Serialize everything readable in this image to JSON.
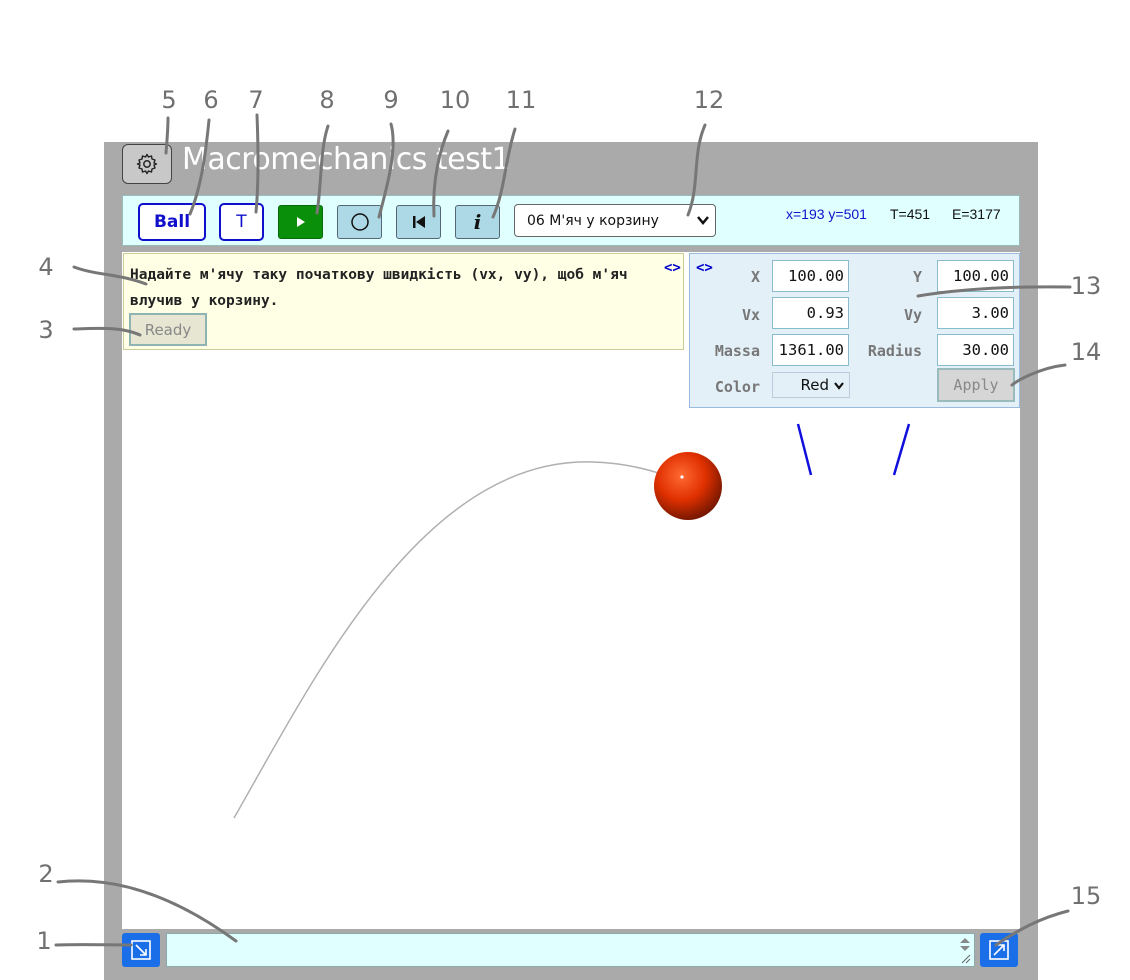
{
  "app": {
    "title": "Macromechanics test1"
  },
  "toolbar": {
    "ball_label": "Ball",
    "t_label": "T",
    "scenario_selected": "06 М'яч у корзину",
    "status": {
      "xy": "x=193 y=501",
      "t": "T=451",
      "e": "E=3177"
    }
  },
  "message": {
    "text": "Надайте м'ячу таку початкову швидкість (vx, vy), щоб м'яч влучив у корзину.",
    "toggle": "<>",
    "ready_label": "Ready"
  },
  "properties": {
    "toggle": "<>",
    "x_label": "X",
    "x_value": "100.00",
    "y_label": "Y",
    "y_value": "100.00",
    "vx_label": "Vx",
    "vx_value": "0.93",
    "vy_label": "Vy",
    "vy_value": "3.00",
    "mass_label": "Massa",
    "mass_value": "1361.00",
    "radius_label": "Radius",
    "radius_value": "30.00",
    "color_label": "Color",
    "color_value": "Red",
    "apply_label": "Apply"
  },
  "callouts": [
    "1",
    "2",
    "3",
    "4",
    "5",
    "6",
    "7",
    "8",
    "9",
    "10",
    "11",
    "12",
    "13",
    "14",
    "15"
  ],
  "colors": {
    "frame": "#aaaaaa",
    "toolbar_bg": "#e0ffff",
    "play_green": "#0a8f0a",
    "tool_blue": "#add8e6",
    "accent_blue": "#1010cc",
    "ball_red": "#e03000",
    "message_bg": "#ffffe6",
    "props_bg": "#e4f0f8",
    "bottom_btn_blue": "#1a6fe8"
  },
  "icons": [
    "gear-icon",
    "play-icon",
    "circle-icon",
    "rewind-icon",
    "info-icon",
    "chevron-down-icon",
    "resize-in-icon",
    "resize-out-icon"
  ]
}
